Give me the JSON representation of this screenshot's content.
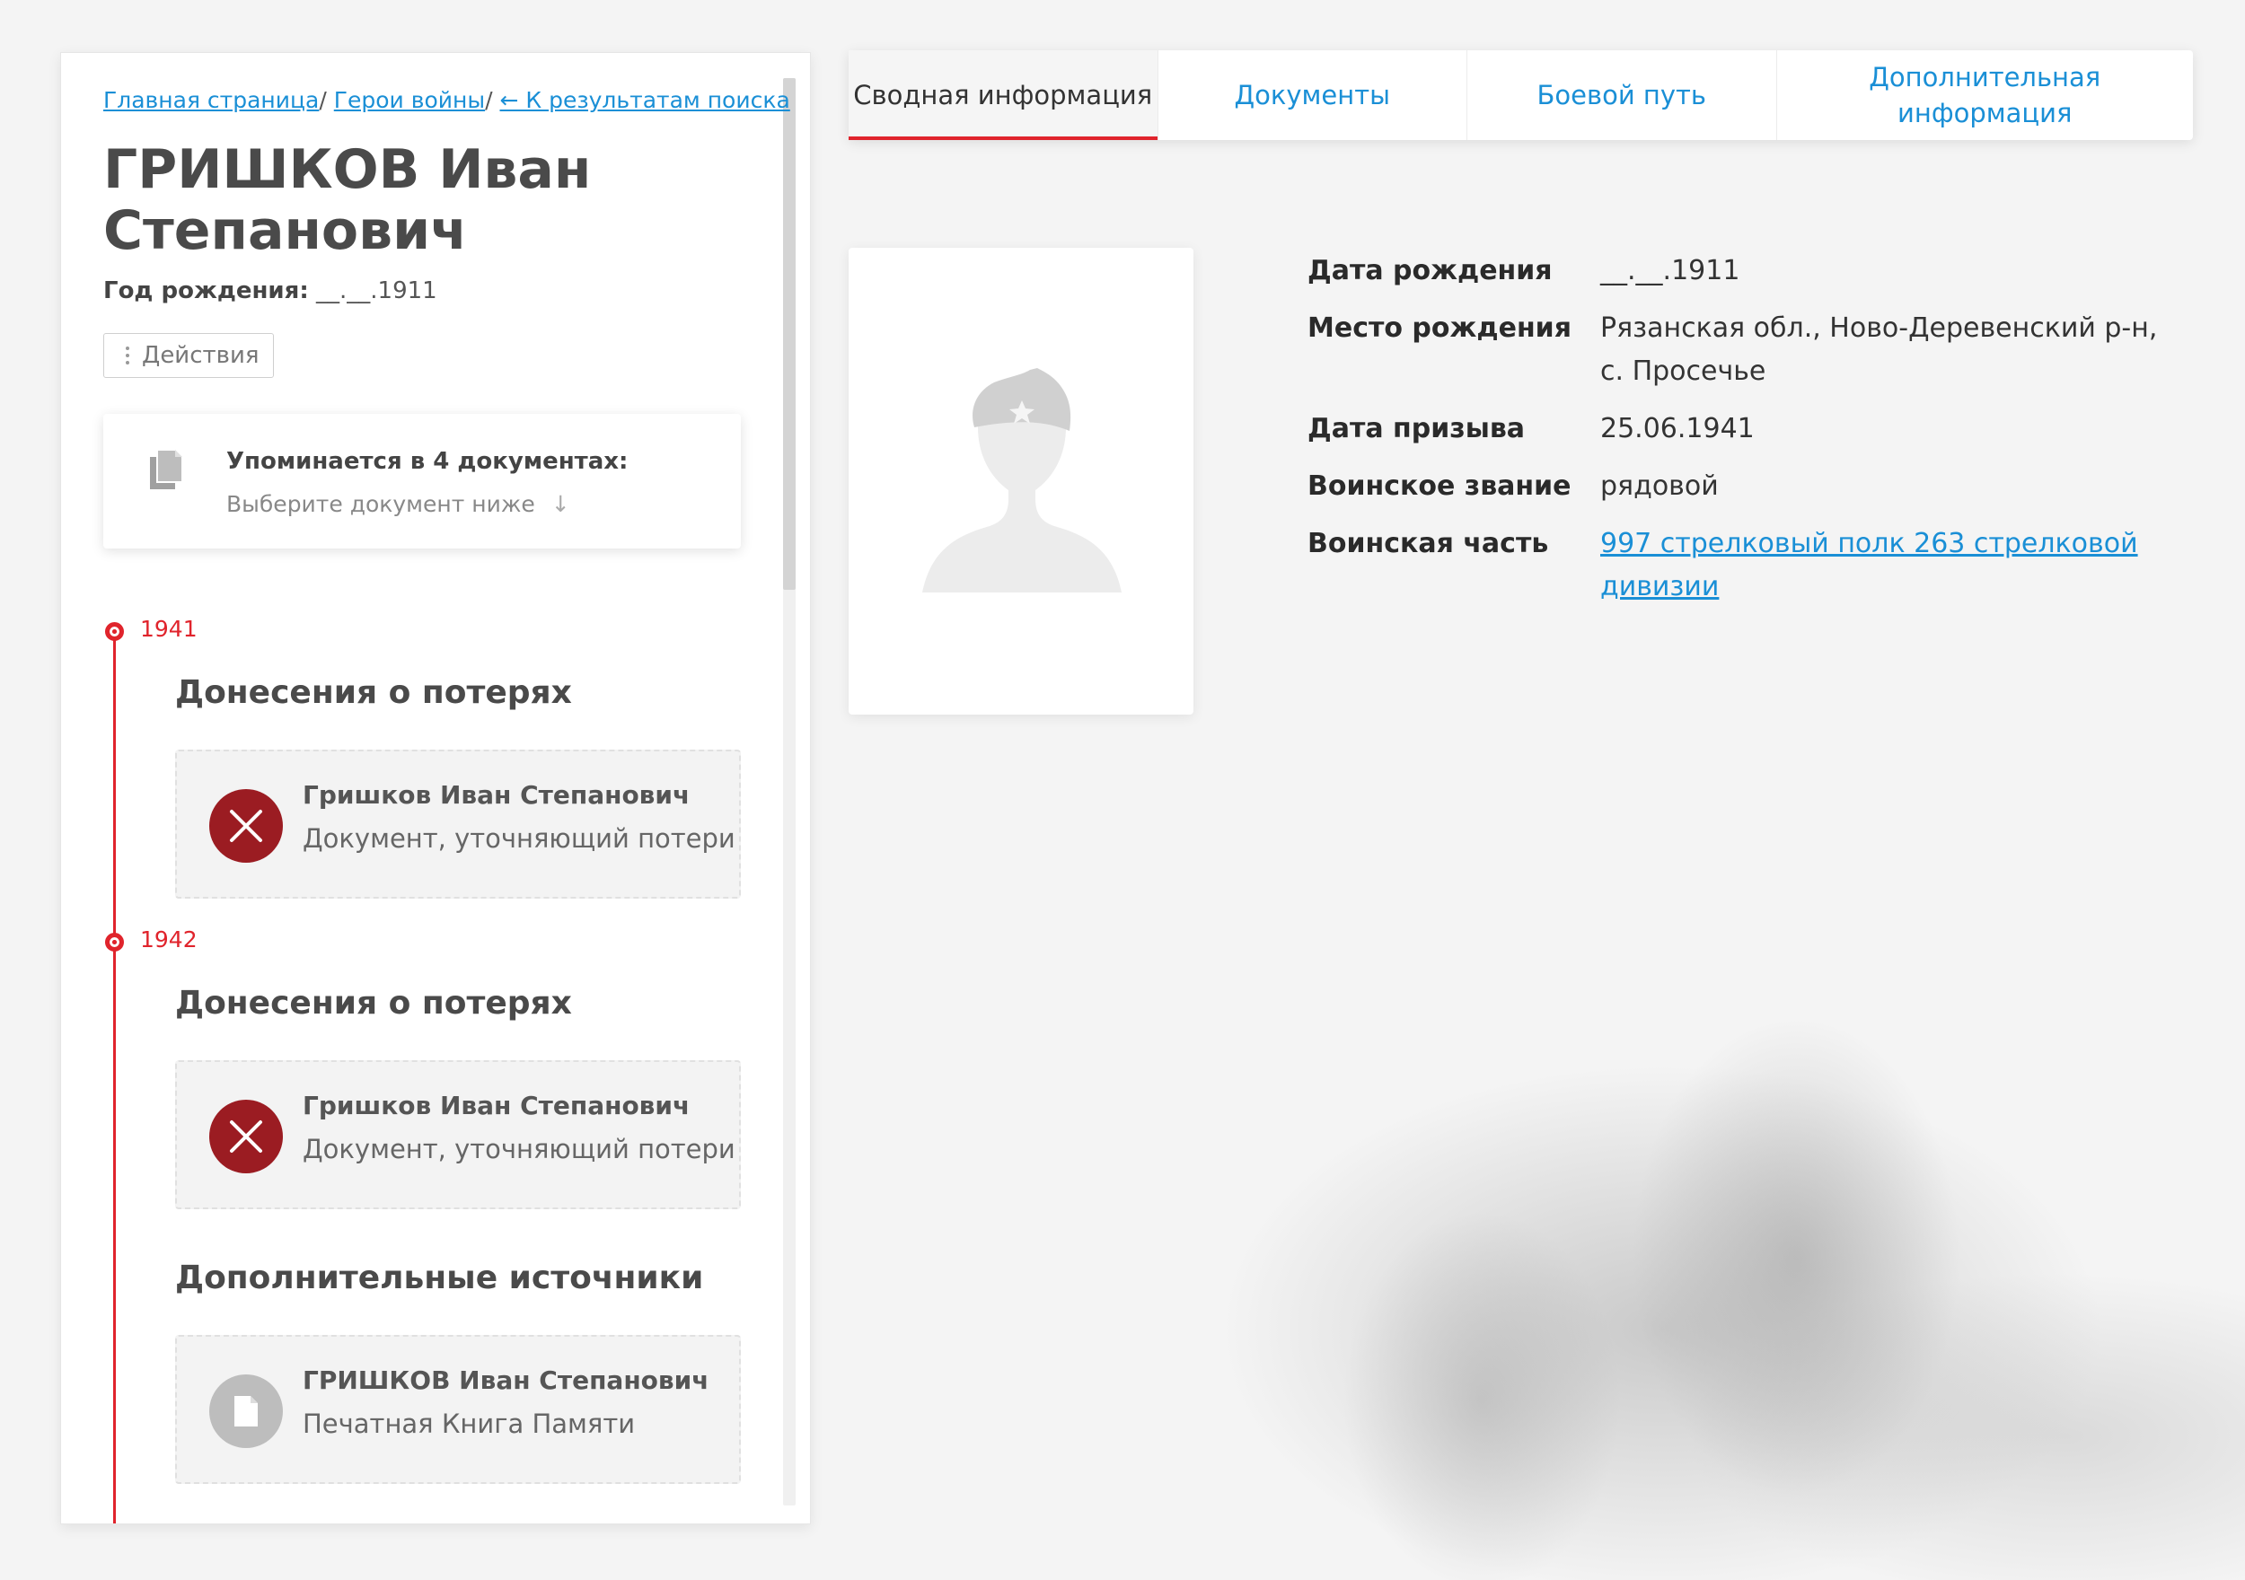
{
  "breadcrumb": {
    "home": "Главная страница",
    "heroes": "Герои войны",
    "back": "← К результатам поиска",
    "sep": "/"
  },
  "person": {
    "name": "ГРИШКОВ Иван Степанович",
    "birth_label": "Год рождения:",
    "birth_value": "__.__.1911"
  },
  "actions_label": "Действия",
  "mentions": {
    "title": "Упоминается в 4 документах:",
    "subtitle": "Выберите документ ниже"
  },
  "timeline": [
    {
      "year": "1941",
      "section": "Донесения о потерях",
      "doc": {
        "name": "Гришков Иван Степанович",
        "type": "Документ, уточняющий потери",
        "icon": "close-icon"
      }
    },
    {
      "year": "1942",
      "section": "Донесения о потерях",
      "doc": {
        "name": "Гришков Иван Степанович",
        "type": "Документ, уточняющий потери",
        "icon": "close-icon"
      }
    }
  ],
  "extra_sources": {
    "section": "Дополнительные источники",
    "doc": {
      "name": "ГРИШКОВ Иван Степанович",
      "type": "Печатная Книга Памяти",
      "icon": "document-icon"
    }
  },
  "tabs": [
    {
      "label": "Сводная информация",
      "active": true
    },
    {
      "label": "Документы",
      "active": false
    },
    {
      "label": "Боевой путь",
      "active": false
    },
    {
      "label": "Дополнительная информация",
      "active": false
    }
  ],
  "info": {
    "birth_date": {
      "label": "Дата рождения",
      "value": "__.__.1911"
    },
    "birth_place": {
      "label": "Место рождения",
      "value": "Рязанская обл., Ново-Деревенский р-н, с. Просечье"
    },
    "draft_date": {
      "label": "Дата призыва",
      "value": "25.06.1941"
    },
    "rank": {
      "label": "Воинское звание",
      "value": "рядовой"
    },
    "unit": {
      "label": "Воинская часть",
      "value": "997 стрелковый полк 263 стрелковой дивизии"
    }
  },
  "colors": {
    "accent_red": "#e0242c",
    "link_blue": "#1a8fd6",
    "dark_red_icon": "#9b1c22"
  }
}
